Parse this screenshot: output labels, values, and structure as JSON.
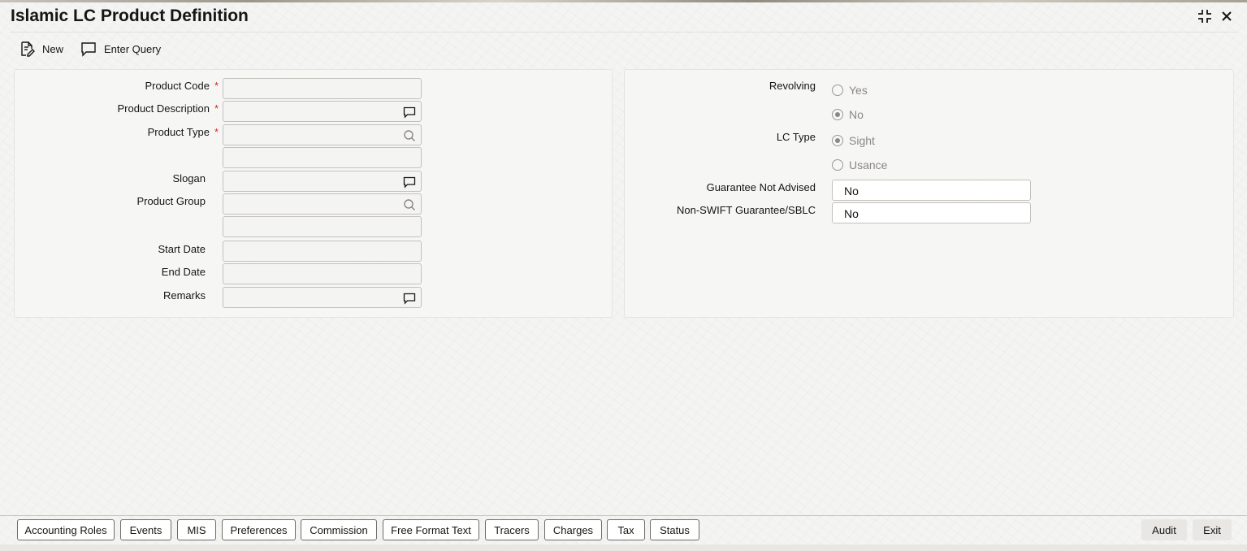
{
  "window": {
    "title": "Islamic LC Product Definition"
  },
  "toolbar": {
    "new_label": "New",
    "enter_query_label": "Enter Query"
  },
  "left_panel": {
    "product_code_label": "Product Code",
    "product_description_label": "Product Description",
    "product_type_label": "Product Type",
    "slogan_label": "Slogan",
    "product_group_label": "Product Group",
    "start_date_label": "Start Date",
    "end_date_label": "End Date",
    "remarks_label": "Remarks",
    "required_marker": "*"
  },
  "right_panel": {
    "revolving_label": "Revolving",
    "revolving_options": [
      "Yes",
      "No"
    ],
    "revolving_selected": "No",
    "lc_type_label": "LC Type",
    "lc_type_options": [
      "Sight",
      "Usance"
    ],
    "lc_type_selected": "Sight",
    "guarantee_not_advised_label": "Guarantee Not Advised",
    "guarantee_not_advised_value": "No",
    "non_swift_label": "Non-SWIFT Guarantee/SBLC",
    "non_swift_value": "No"
  },
  "footer": {
    "buttons": [
      "Accounting Roles",
      "Events",
      "MIS",
      "Preferences",
      "Commission",
      "Free Format Text",
      "Tracers",
      "Charges",
      "Tax",
      "Status"
    ],
    "audit_label": "Audit",
    "exit_label": "Exit"
  },
  "icons": {
    "new": "new-document-icon",
    "enter_query": "chat-bubble-icon",
    "description": "comment-icon",
    "lookup": "search-icon",
    "minimize": "collapse-icon",
    "close": "close-icon"
  },
  "colors": {
    "required": "#c7361f",
    "text": "#161513",
    "disabled_text": "#8b8782"
  }
}
